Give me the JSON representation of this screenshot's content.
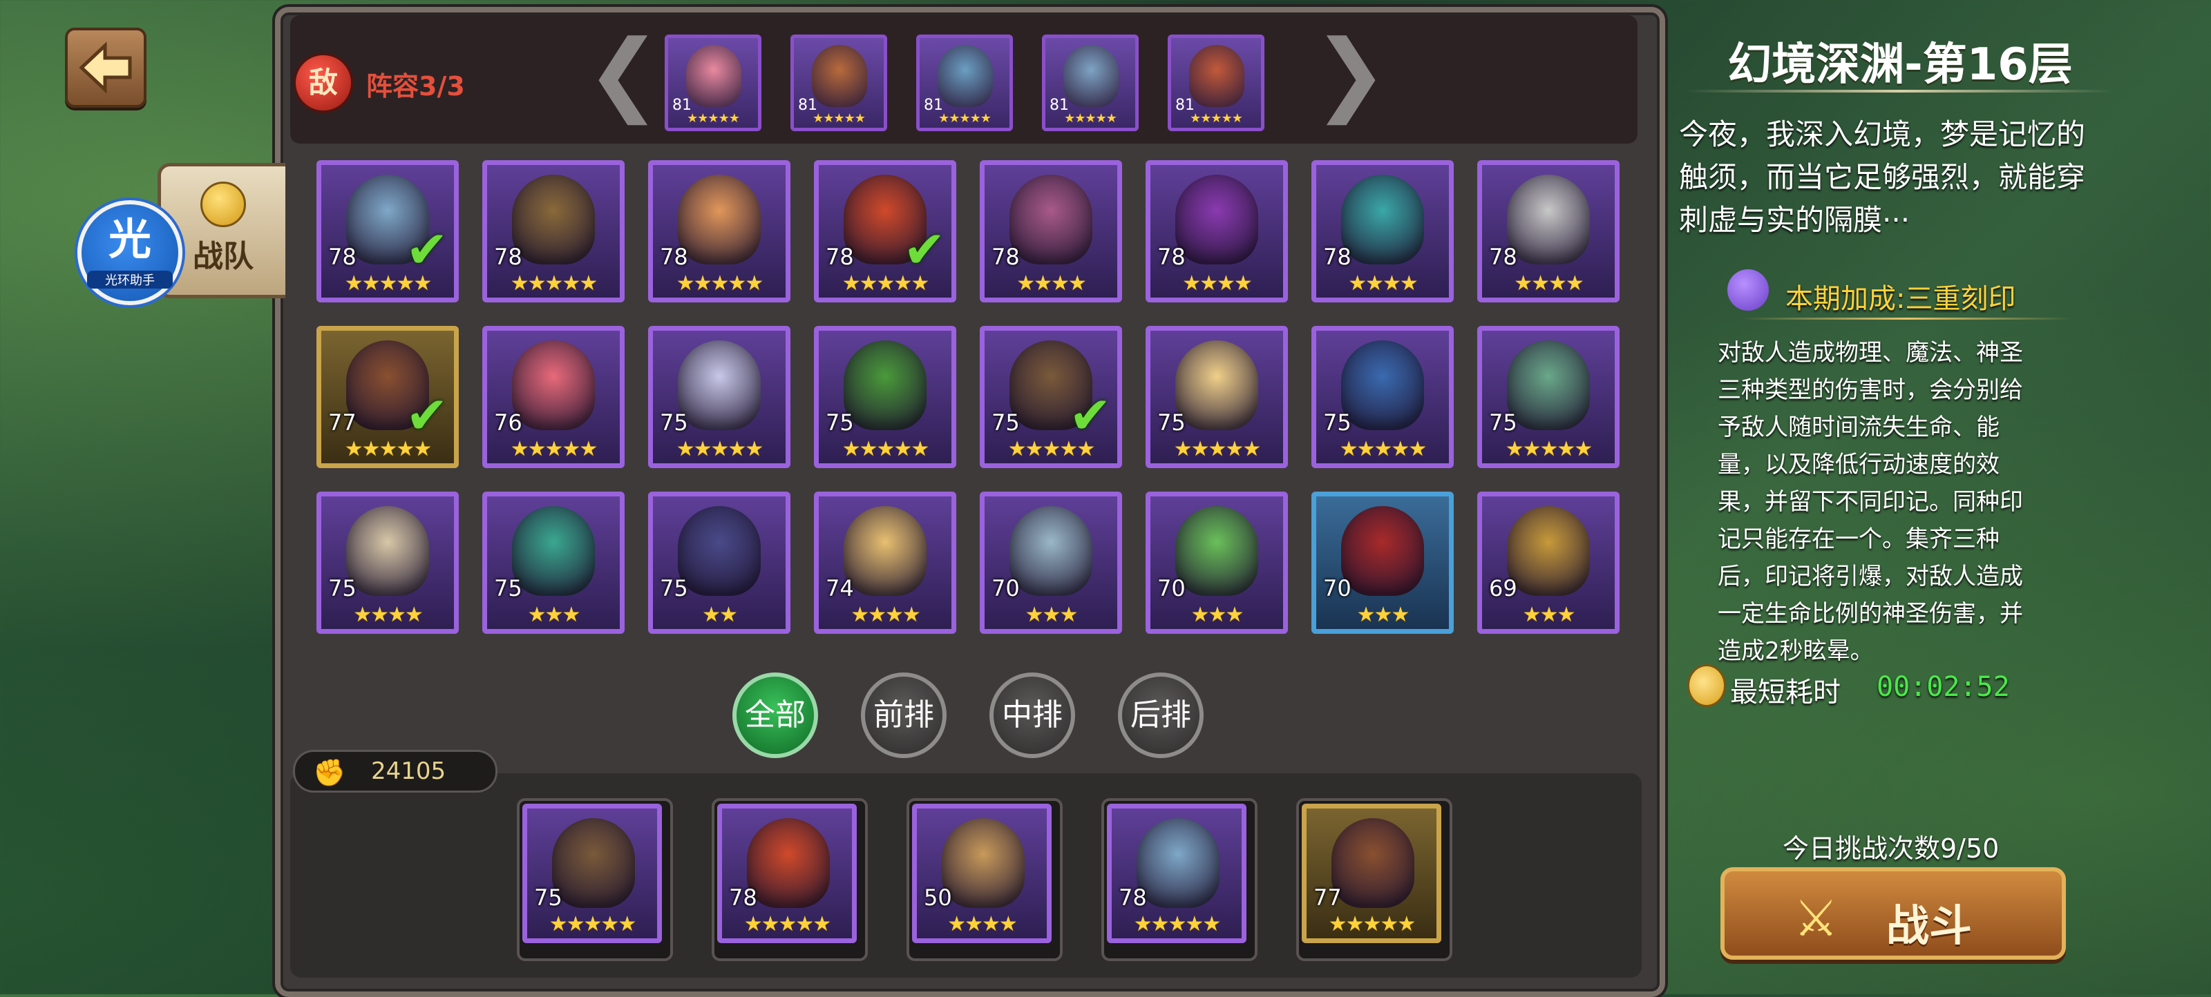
{
  "header": {
    "stage_title": "幻境深渊-第16层"
  },
  "left": {
    "aura_badge_big": "光",
    "aura_badge_small": "光环助手",
    "team_tab_label": "战队"
  },
  "enemy": {
    "badge": "敌",
    "label": "阵容3/3",
    "arrow_left": "❮",
    "arrow_right": "❯",
    "portraits": [
      {
        "level": "81",
        "stars": "★★★★★",
        "color": "#e98aa0"
      },
      {
        "level": "81",
        "stars": "★★★★★",
        "color": "#b86b3b"
      },
      {
        "level": "81",
        "stars": "★★★★★",
        "color": "#6b9fc2"
      },
      {
        "level": "81",
        "stars": "★★★★★",
        "color": "#7fa4c4"
      },
      {
        "level": "81",
        "stars": "★★★★★",
        "color": "#c25a3a"
      }
    ]
  },
  "heroes": [
    {
      "level": "78",
      "stars": "★★★★★",
      "selected": true,
      "color": "#7fa8c8",
      "frame": "purple"
    },
    {
      "level": "78",
      "stars": "★★★★★",
      "selected": false,
      "color": "#8a6a3a",
      "frame": "purple"
    },
    {
      "level": "78",
      "stars": "★★★★★",
      "selected": false,
      "color": "#e2975a",
      "frame": "purple"
    },
    {
      "level": "78",
      "stars": "★★★★★",
      "selected": true,
      "color": "#d04a2a",
      "frame": "purple"
    },
    {
      "level": "78",
      "stars": "★★★★",
      "selected": false,
      "color": "#a85a8a",
      "frame": "purple"
    },
    {
      "level": "78",
      "stars": "★★★★",
      "selected": false,
      "color": "#8a3ab0",
      "frame": "purple"
    },
    {
      "level": "78",
      "stars": "★★★★",
      "selected": false,
      "color": "#3aa8a8",
      "frame": "purple"
    },
    {
      "level": "78",
      "stars": "★★★★",
      "selected": false,
      "color": "#c8c8c8",
      "frame": "purple"
    },
    {
      "level": "77",
      "stars": "★★★★★",
      "selected": true,
      "color": "#8a5030",
      "frame": "gold"
    },
    {
      "level": "76",
      "stars": "★★★★★",
      "selected": false,
      "color": "#e86a7a",
      "frame": "purple"
    },
    {
      "level": "75",
      "stars": "★★★★★",
      "selected": false,
      "color": "#c8c8e8",
      "frame": "purple"
    },
    {
      "level": "75",
      "stars": "★★★★★",
      "selected": false,
      "color": "#4a9a3a",
      "frame": "purple"
    },
    {
      "level": "75",
      "stars": "★★★★★",
      "selected": true,
      "color": "#7a5a3a",
      "frame": "purple"
    },
    {
      "level": "75",
      "stars": "★★★★★",
      "selected": false,
      "color": "#f0d08a",
      "frame": "purple"
    },
    {
      "level": "75",
      "stars": "★★★★★",
      "selected": false,
      "color": "#3a6ab0",
      "frame": "purple"
    },
    {
      "level": "75",
      "stars": "★★★★★",
      "selected": false,
      "color": "#6aa88a",
      "frame": "purple"
    },
    {
      "level": "75",
      "stars": "★★★★",
      "selected": false,
      "color": "#d8c8a8",
      "frame": "purple"
    },
    {
      "level": "75",
      "stars": "★★★",
      "selected": false,
      "color": "#3aa890",
      "frame": "purple"
    },
    {
      "level": "75",
      "stars": "★★",
      "selected": false,
      "color": "#4a4a8a",
      "frame": "purple"
    },
    {
      "level": "74",
      "stars": "★★★★",
      "selected": false,
      "color": "#e8c070",
      "frame": "purple"
    },
    {
      "level": "70",
      "stars": "★★★",
      "selected": false,
      "color": "#9ab8c8",
      "frame": "purple"
    },
    {
      "level": "70",
      "stars": "★★★",
      "selected": false,
      "color": "#6ac05a",
      "frame": "purple"
    },
    {
      "level": "70",
      "stars": "★★★",
      "selected": false,
      "color": "#a82a2a",
      "frame": "blue"
    },
    {
      "level": "69",
      "stars": "★★★",
      "selected": false,
      "color": "#c89a3a",
      "frame": "purple"
    }
  ],
  "filters": [
    {
      "label": "全部",
      "active": true
    },
    {
      "label": "前排",
      "active": false
    },
    {
      "label": "中排",
      "active": false
    },
    {
      "label": "后排",
      "active": false
    }
  ],
  "power": {
    "icon": "fist-icon",
    "value": "24105"
  },
  "lineup": [
    {
      "level": "75",
      "stars": "★★★★★",
      "color": "#7a5a3a",
      "frame": "purple"
    },
    {
      "level": "78",
      "stars": "★★★★★",
      "color": "#d04a2a",
      "frame": "purple"
    },
    {
      "level": "50",
      "stars": "★★★★",
      "color": "#c89a5a",
      "frame": "purple"
    },
    {
      "level": "78",
      "stars": "★★★★★",
      "color": "#7fa8c8",
      "frame": "purple"
    },
    {
      "level": "77",
      "stars": "★★★★★",
      "color": "#8a5030",
      "frame": "gold"
    }
  ],
  "side": {
    "description": "今夜，我深入幻境，梦是记忆的触须，而当它足够强烈，就能穿刺虚与实的隔膜···",
    "bonus_label": "本期加成:三重刻印",
    "effect": "对敌人造成物理、魔法、神圣三种类型的伤害时，会分别给予敌人随时间流失生命、能量，以及降低行动速度的效果，并留下不同印记。同种印记只能存在一个。集齐三种后，印记将引爆，对敌人造成一定生命比例的神圣伤害，并造成2秒眩晕。",
    "timer_label": "最短耗时",
    "timer_value": "00:02:52",
    "attempts": "今日挑战次数9/50",
    "fight_label": "战斗"
  }
}
